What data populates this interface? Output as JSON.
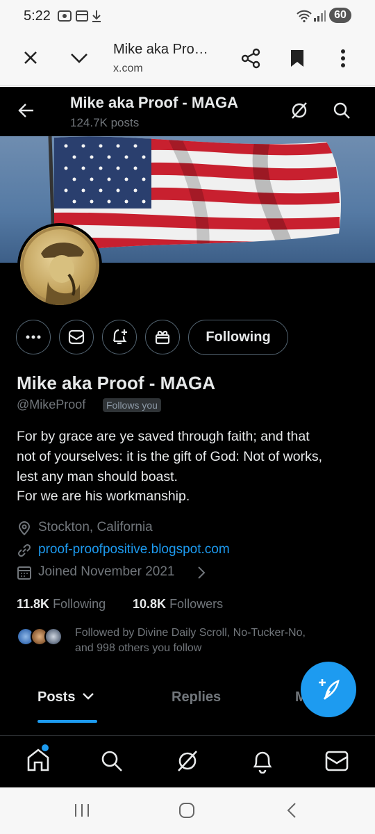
{
  "status_bar": {
    "time": "5:22",
    "battery": "60"
  },
  "browser": {
    "tab_title": "Mike aka Pro…",
    "url": "x.com"
  },
  "header": {
    "name": "Mike aka Proof - MAGA",
    "post_count": "124.7K posts"
  },
  "profile": {
    "display_name": "Mike aka Proof - MAGA",
    "handle": "@MikeProof",
    "follows_you": "Follows you",
    "following_button": "Following",
    "bio": [
      "For by grace are ye saved through faith; and that",
      "not of yourselves: it is the gift of God: Not of works,",
      "lest any man should boast.",
      "For we are his workmanship."
    ],
    "location": "Stockton, California",
    "website": "proof-proofpositive.blogspot.com",
    "joined": "Joined November 2021",
    "following_count": "11.8K",
    "following_label": "Following",
    "followers_count": "10.8K",
    "followers_label": "Followers",
    "followed_by": [
      "Followed by Divine Daily Scroll, No-Tucker-No,",
      "and 998 others you follow"
    ]
  },
  "tabs": {
    "posts": "Posts",
    "replies": "Replies",
    "media": "M"
  },
  "colors": {
    "accent": "#1d9bf0",
    "background": "#000000",
    "text_primary": "#e7e9ea",
    "text_secondary": "#71767b"
  }
}
